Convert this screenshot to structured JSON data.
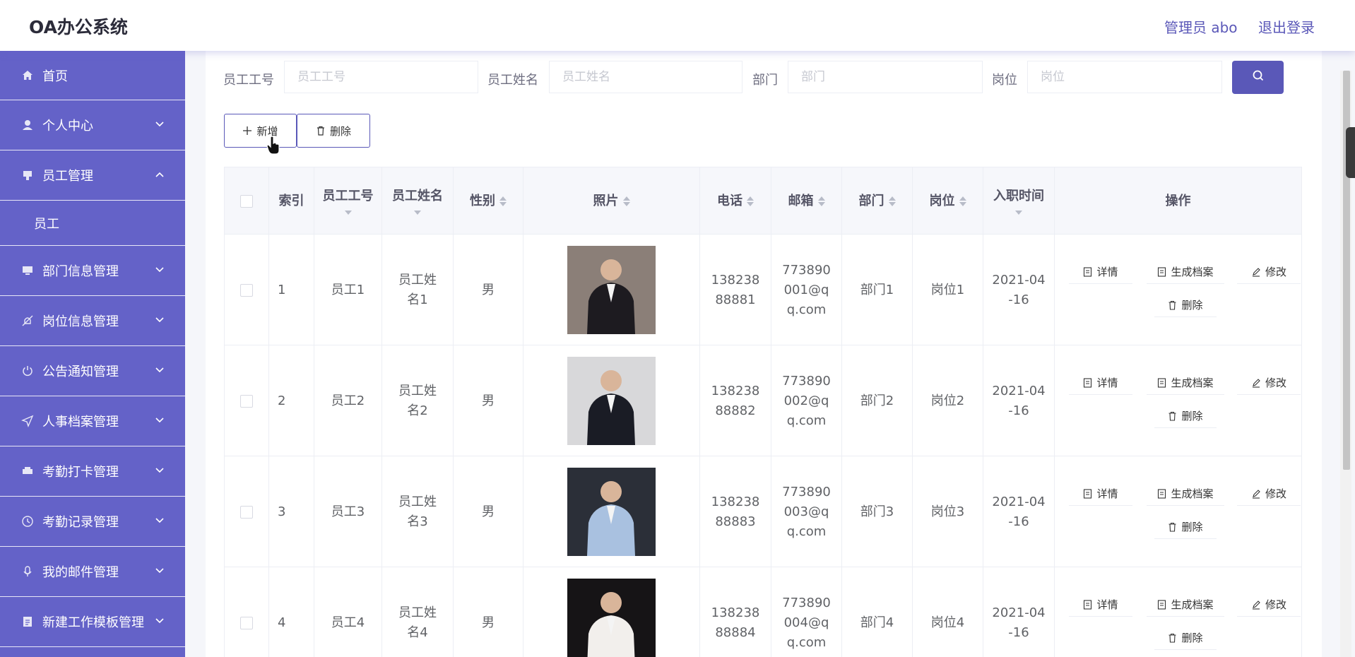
{
  "app": {
    "title": "OA办公系统",
    "user_label": "管理员 abo",
    "logout_label": "退出登录"
  },
  "sidebar": {
    "items": [
      {
        "label": "首页",
        "icon": "home-icon"
      },
      {
        "label": "个人中心",
        "icon": "user-icon"
      },
      {
        "label": "员工管理",
        "icon": "staff-icon",
        "expanded": true,
        "children": [
          {
            "label": "员工"
          }
        ]
      },
      {
        "label": "部门信息管理",
        "icon": "monitor-icon"
      },
      {
        "label": "岗位信息管理",
        "icon": "bell-off-icon"
      },
      {
        "label": "公告通知管理",
        "icon": "power-icon"
      },
      {
        "label": "人事档案管理",
        "icon": "send-icon"
      },
      {
        "label": "考勤打卡管理",
        "icon": "printer-icon"
      },
      {
        "label": "考勤记录管理",
        "icon": "clock-icon"
      },
      {
        "label": "我的邮件管理",
        "icon": "microphone-icon"
      },
      {
        "label": "新建工作模板管理",
        "icon": "document-icon"
      }
    ]
  },
  "search": {
    "fields": [
      {
        "label": "员工工号",
        "placeholder": "员工工号"
      },
      {
        "label": "员工姓名",
        "placeholder": "员工姓名"
      },
      {
        "label": "部门",
        "placeholder": "部门"
      },
      {
        "label": "岗位",
        "placeholder": "岗位"
      }
    ],
    "button_icon": "search-icon"
  },
  "toolbar": {
    "add_label": "新增",
    "delete_label": "删除"
  },
  "table": {
    "headers": [
      "索引",
      "员工工号",
      "员工姓名",
      "性别",
      "照片",
      "电话",
      "邮箱",
      "部门",
      "岗位",
      "入职时间",
      "操作"
    ],
    "rows": [
      {
        "index": "1",
        "emp_no": "员工1",
        "name": "员工姓名1",
        "gender": "男",
        "phone": "13823888881",
        "email": "773890001@qq.com",
        "dept": "部门1",
        "post": "岗位1",
        "date": "2021-04-16",
        "photo_bg": "#8b7f78",
        "suit": "#1d1b20"
      },
      {
        "index": "2",
        "emp_no": "员工2",
        "name": "员工姓名2",
        "gender": "男",
        "phone": "13823888882",
        "email": "773890002@qq.com",
        "dept": "部门2",
        "post": "岗位2",
        "date": "2021-04-16",
        "photo_bg": "#d8d8da",
        "suit": "#1a1c25"
      },
      {
        "index": "3",
        "emp_no": "员工3",
        "name": "员工姓名3",
        "gender": "男",
        "phone": "13823888883",
        "email": "773890003@qq.com",
        "dept": "部门3",
        "post": "岗位3",
        "date": "2021-04-16",
        "photo_bg": "#2b2f38",
        "suit": "#a9c1e0"
      },
      {
        "index": "4",
        "emp_no": "员工4",
        "name": "员工姓名4",
        "gender": "男",
        "phone": "13823888884",
        "email": "773890004@qq.com",
        "dept": "部门4",
        "post": "岗位4",
        "date": "2021-04-16",
        "photo_bg": "#161416",
        "suit": "#f2efec"
      }
    ],
    "actions": {
      "detail": "详情",
      "archive": "生成档案",
      "edit": "修改",
      "delete": "删除"
    }
  },
  "colors": {
    "accent": "#5a58b8",
    "sidebar": "#6462c8"
  }
}
